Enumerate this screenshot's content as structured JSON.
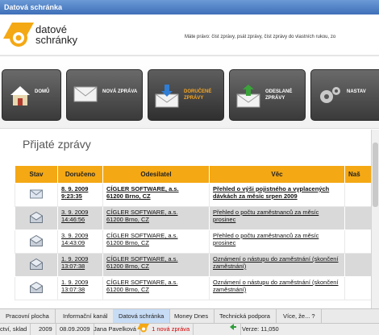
{
  "window": {
    "title": "Datová schránka"
  },
  "header": {
    "logo_line1": "datové",
    "logo_line2": "schránky",
    "permissions": "Máte právo: číst zprávy, psát zprávy, číst zprávy do vlastních rukou, zo"
  },
  "toolbar": {
    "buttons": [
      {
        "label": "Domů"
      },
      {
        "label": "Nová zpráva"
      },
      {
        "label": "Doručené zprávy"
      },
      {
        "label": "Odeslané zprávy"
      },
      {
        "label": "Nastav"
      }
    ]
  },
  "main": {
    "title": "Přijaté zprávy",
    "table": {
      "columns": [
        "Stav",
        "Doručeno",
        "Odesilatel",
        "Věc",
        "Naš"
      ],
      "rows": [
        {
          "date": "8. 9. 2009",
          "time": "9:23:35",
          "sender": "CÍGLER SOFTWARE, a.s.",
          "address": "61200 Brno, CZ",
          "subject": "Přehled o výši pojistného a vyplacených dávkách za měsíc srpen 2009",
          "status": "unread"
        },
        {
          "date": "3. 9. 2009",
          "time": "14:46:56",
          "sender": "CÍGLER SOFTWARE, a.s.",
          "address": "61200 Brno, CZ",
          "subject": "Přehled o počtu zaměstnanců za měsíc prosinec",
          "status": "read"
        },
        {
          "date": "3. 9. 2009",
          "time": "14:43:09",
          "sender": "CÍGLER SOFTWARE, a.s.",
          "address": "61200 Brno, CZ",
          "subject": "Přehled o počtu zaměstnanců za měsíc prosinec",
          "status": "read"
        },
        {
          "date": "1. 9. 2009",
          "time": "13:07:38",
          "sender": "CÍGLER SOFTWARE, a.s.",
          "address": "61200 Brno, CZ",
          "subject": "Oznámení o nástupu do zaměstnání (skončení zaměstnání)",
          "status": "read"
        },
        {
          "date": "1. 9. 2009",
          "time": "13:07:38",
          "sender": "CÍGLER SOFTWARE, a.s.",
          "address": "61200 Brno, CZ",
          "subject": "Oznámení o nástupu do zaměstnání (skončení zaměstnání)",
          "status": "read"
        }
      ]
    }
  },
  "tabs": [
    {
      "label": "Pracovní plocha"
    },
    {
      "label": "Informační kanál"
    },
    {
      "label": "Datová schránka"
    },
    {
      "label": "Money Dnes"
    },
    {
      "label": "Technická podpora"
    },
    {
      "label": "Více, že... ?"
    }
  ],
  "status": {
    "agenda": "ctví, sklad",
    "year": "2009",
    "date": "08.09.2009",
    "user": "Jana Pavelková",
    "new_message": "1 nová zpráva",
    "version": "Verze: 11,050"
  },
  "colors": {
    "accent": "#f4a814",
    "title_bar": "#3f6fb8",
    "active_tab": "#c7dcf5",
    "new_message": "#d40000"
  }
}
